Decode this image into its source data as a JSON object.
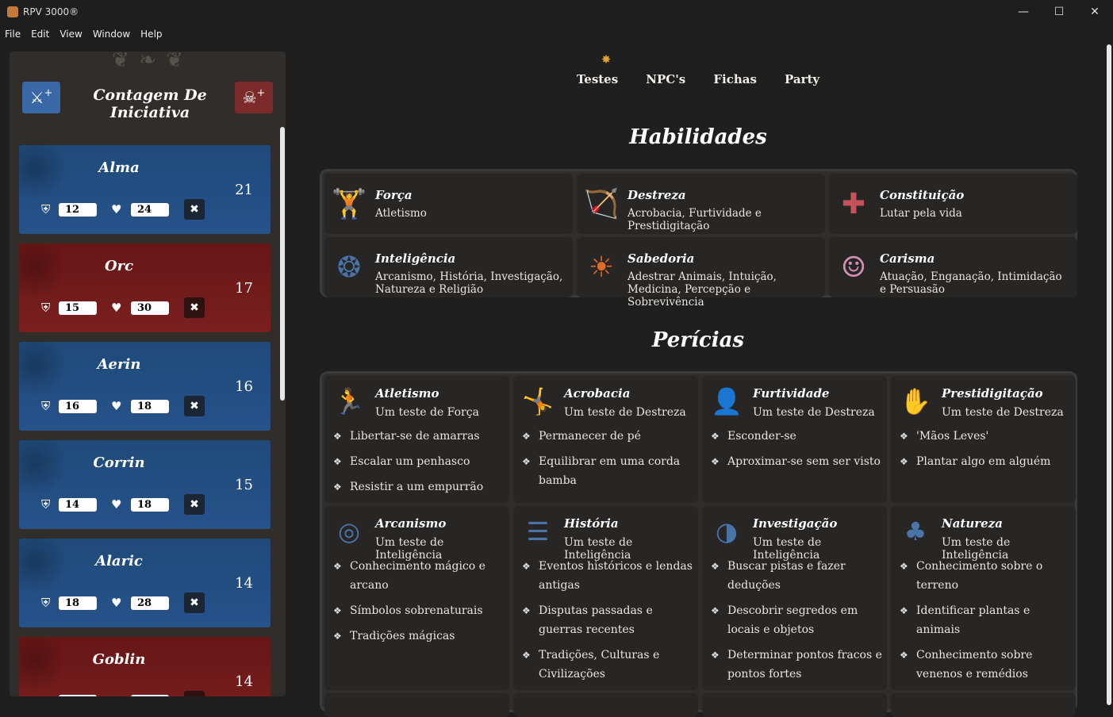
{
  "window": {
    "title": "RPV 3000®"
  },
  "menu": [
    "File",
    "Edit",
    "View",
    "Window",
    "Help"
  ],
  "sidebar": {
    "title": "Contagem De Iniciativa",
    "cards": [
      {
        "name": "Alma",
        "initiative": "21",
        "armor": "12",
        "hp": "24",
        "color": "blue"
      },
      {
        "name": "Orc",
        "initiative": "17",
        "armor": "15",
        "hp": "30",
        "color": "red"
      },
      {
        "name": "Aerin",
        "initiative": "16",
        "armor": "16",
        "hp": "18",
        "color": "blue"
      },
      {
        "name": "Corrin",
        "initiative": "15",
        "armor": "14",
        "hp": "18",
        "color": "blue"
      },
      {
        "name": "Alaric",
        "initiative": "14",
        "armor": "18",
        "hp": "28",
        "color": "blue"
      },
      {
        "name": "Goblin",
        "initiative": "14",
        "armor": "",
        "hp": "",
        "color": "red"
      }
    ]
  },
  "nav": [
    "Testes",
    "NPC's",
    "Fichas",
    "Party"
  ],
  "habilidades": {
    "title": "Habilidades",
    "items": [
      {
        "title": "Força",
        "desc": "Atletismo",
        "icon": "weightlifter-icon",
        "color": "#d49a3a"
      },
      {
        "title": "Destreza",
        "desc": "Acrobacia, Furtividade e Prestidigitação",
        "icon": "archer-icon",
        "color": "#3f8a6a"
      },
      {
        "title": "Constituição",
        "desc": "Lutar pela vida",
        "icon": "health-cross-icon",
        "color": "#c4525a"
      },
      {
        "title": "Inteligência",
        "desc": "Arcanismo, História, Investigação, Natureza e Religião",
        "icon": "brain-icon",
        "color": "#4a74a8"
      },
      {
        "title": "Sabedoria",
        "desc": "Adestrar Animais, Intuição, Medicina, Percepção e Sobrevivência",
        "icon": "sage-icon",
        "color": "#e06a2a"
      },
      {
        "title": "Carisma",
        "desc": "Atuação, Enganação, Intimidação e Persuasão",
        "icon": "theater-masks-icon",
        "color": "#d292b4"
      }
    ]
  },
  "pericias": {
    "title": "Perícias",
    "items": [
      {
        "title": "Atletismo",
        "sub": "Um teste de Força",
        "icon": "jumping-figure-icon",
        "color": "#d49a3a",
        "bullets": [
          "Libertar-se de amarras",
          "Escalar um penhasco",
          "Resistir a um empurrão"
        ]
      },
      {
        "title": "Acrobacia",
        "sub": "Um teste de Destreza",
        "icon": "acrobat-icon",
        "color": "#3f8a6a",
        "bullets": [
          "Permanecer de pé",
          "Equilibrar em uma corda bamba"
        ]
      },
      {
        "title": "Furtividade",
        "sub": "Um teste de Destreza",
        "icon": "masked-figure-icon",
        "color": "#3f8a6a",
        "bullets": [
          "Esconder-se",
          "Aproximar-se sem ser visto"
        ]
      },
      {
        "title": "Prestidigitação",
        "sub": "Um teste de Destreza",
        "icon": "hand-trick-icon",
        "color": "#3f8a6a",
        "bullets": [
          "'Mãos Leves'",
          "Plantar algo em alguém"
        ]
      },
      {
        "title": "Arcanismo",
        "sub": "Um teste de Inteligência",
        "icon": "crystal-ball-icon",
        "color": "#4a74a8",
        "bullets": [
          "Conhecimento mágico e arcano",
          "Símbolos sobrenaturais",
          "Tradições mágicas"
        ]
      },
      {
        "title": "História",
        "sub": "Um teste de Inteligência",
        "icon": "books-icon",
        "color": "#4a74a8",
        "bullets": [
          "Eventos históricos e lendas antigas",
          "Disputas passadas e guerras recentes",
          "Tradições, Culturas e Civilizações"
        ]
      },
      {
        "title": "Investigação",
        "sub": "Um teste de Inteligência",
        "icon": "detective-icon",
        "color": "#4a74a8",
        "bullets": [
          "Buscar pistas e fazer deduções",
          "Descobrir segredos em locais e objetos",
          "Determinar pontos fracos e pontos fortes"
        ]
      },
      {
        "title": "Natureza",
        "sub": "Um teste de Inteligência",
        "icon": "pine-tree-icon",
        "color": "#4a74a8",
        "bullets": [
          "Conhecimento sobre o terreno",
          "Identificar plantas e animais",
          "Conhecimento sobre venenos e remédios"
        ]
      }
    ]
  }
}
